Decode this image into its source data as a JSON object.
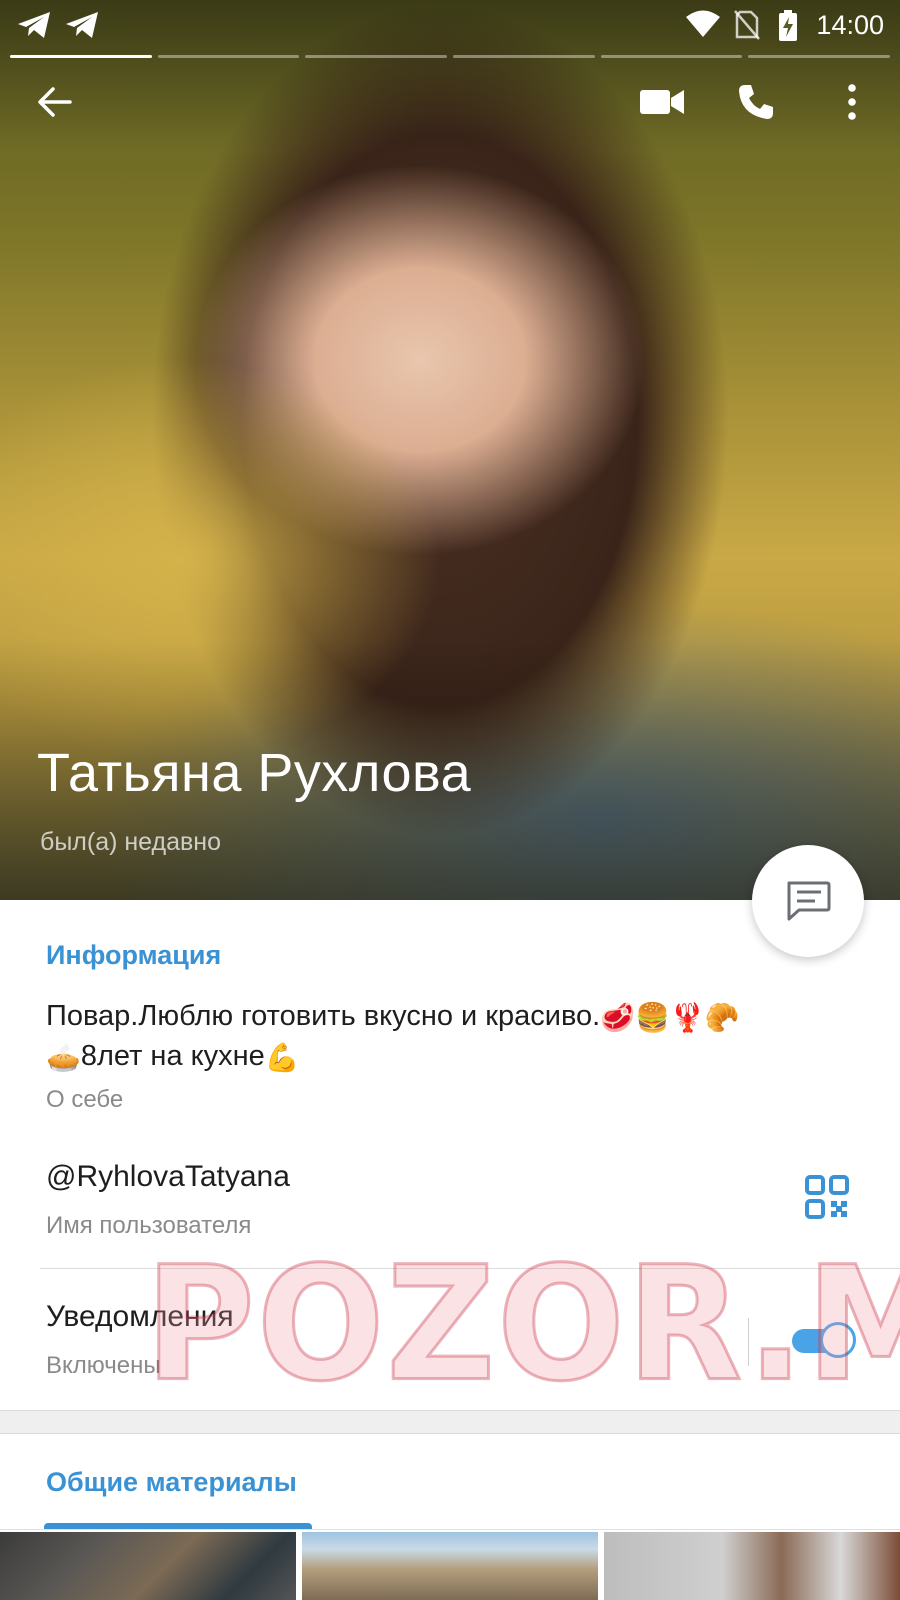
{
  "statusbar": {
    "time": "14:00",
    "left_icons": [
      "telegram-icon",
      "telegram-icon"
    ],
    "right_icons": [
      "wifi-icon",
      "no-sim-icon",
      "battery-charging-icon"
    ]
  },
  "stories": {
    "count": 6,
    "active_index": 0
  },
  "toolbar": {
    "back_icon": "arrow-back-icon",
    "video_call_icon": "video-camera-icon",
    "call_icon": "phone-icon",
    "more_icon": "more-vertical-icon"
  },
  "profile": {
    "name": "Татьяна Рухлова",
    "status": "был(а) недавно"
  },
  "fab": {
    "icon": "message-icon"
  },
  "info": {
    "title": "Информация",
    "bio_line1_text": "Повар.Люблю готовить вкусно и красиво.",
    "bio_line1_emoji": [
      "🥩",
      "🍔",
      "🦞",
      "🥐"
    ],
    "bio_line2_emoji": "🥧",
    "bio_line2_text": "8лет на кухне",
    "bio_line2_emoji_end": "💪",
    "bio_label": "О себе",
    "username": "@RyhlovaTatyana",
    "username_label": "Имя пользователя",
    "qr_icon": "qr-code-icon",
    "notifications": "Уведомления",
    "notifications_state": "Включены",
    "notifications_enabled": true
  },
  "watermark": "POZOR.ME",
  "shared": {
    "title": "Общие материалы",
    "thumbnails": [
      "media-thumb-1",
      "media-thumb-2",
      "media-thumb-3"
    ]
  },
  "colors": {
    "accent": "#3a92d4",
    "toggle": "#4aa3e6"
  }
}
